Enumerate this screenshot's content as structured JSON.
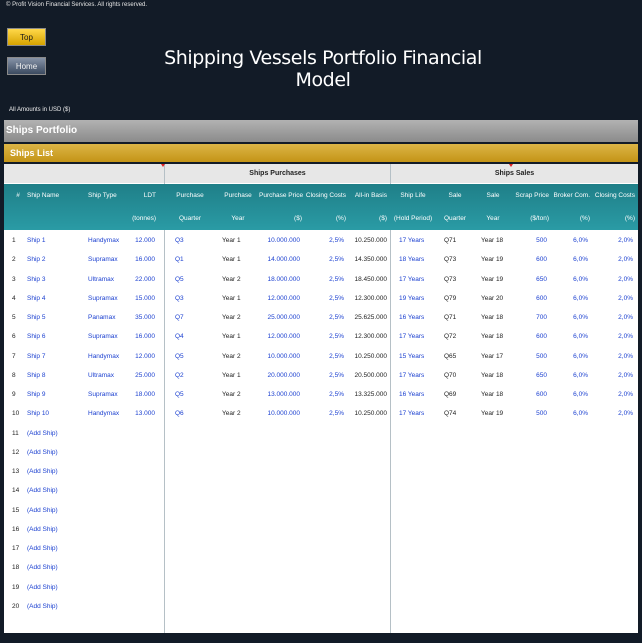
{
  "copyright": "© Profit Vision Financial Services. All rights reserved.",
  "nav": {
    "top_label": "Top",
    "home_label": "Home"
  },
  "title": "Shipping Vessels Portfolio Financial Model",
  "amounts_note": "All Amounts in  USD ($)",
  "section": "Ships Portfolio",
  "subsection": "Ships List",
  "groups": {
    "purchases": "Ships Purchases",
    "sales": "Ships Sales"
  },
  "columns": [
    {
      "key": "num",
      "h1": "#",
      "h2": ""
    },
    {
      "key": "name",
      "h1": "Ship Name",
      "h2": ""
    },
    {
      "key": "type",
      "h1": "Ship Type",
      "h2": ""
    },
    {
      "key": "ldt",
      "h1": "LDT",
      "h2": "(tonnes)"
    },
    {
      "key": "pq",
      "h1": "Purchase",
      "h2": "Quarter"
    },
    {
      "key": "py",
      "h1": "Purchase",
      "h2": "Year"
    },
    {
      "key": "pp",
      "h1": "Purchase Price",
      "h2": "($)"
    },
    {
      "key": "pc",
      "h1": "Closing Costs",
      "h2": "(%)"
    },
    {
      "key": "ab",
      "h1": "All-in Basis",
      "h2": "($)"
    },
    {
      "key": "life",
      "h1": "Ship Life",
      "h2": "(Hold Period)"
    },
    {
      "key": "sq",
      "h1": "Sale",
      "h2": "Quarter"
    },
    {
      "key": "sy",
      "h1": "Sale",
      "h2": "Year"
    },
    {
      "key": "scrap",
      "h1": "Scrap Price",
      "h2": "($/ton)"
    },
    {
      "key": "broker",
      "h1": "Broker Com.",
      "h2": "(%)"
    },
    {
      "key": "sc",
      "h1": "Closing Costs",
      "h2": "(%)"
    }
  ],
  "rows": [
    [
      "1",
      "Ship 1",
      "Handymax",
      "12.000",
      "Q3",
      "Year 1",
      "10.000.000",
      "2,5%",
      "10.250.000",
      "17 Years",
      "Q71",
      "Year 18",
      "500",
      "6,0%",
      "2,0%"
    ],
    [
      "2",
      "Ship 2",
      "Supramax",
      "16.000",
      "Q1",
      "Year 1",
      "14.000.000",
      "2,5%",
      "14.350.000",
      "18 Years",
      "Q73",
      "Year 19",
      "600",
      "6,0%",
      "2,0%"
    ],
    [
      "3",
      "Ship 3",
      "Ultramax",
      "22.000",
      "Q5",
      "Year 2",
      "18.000.000",
      "2,5%",
      "18.450.000",
      "17 Years",
      "Q73",
      "Year 19",
      "650",
      "6,0%",
      "2,0%"
    ],
    [
      "4",
      "Ship 4",
      "Supramax",
      "15.000",
      "Q3",
      "Year 1",
      "12.000.000",
      "2,5%",
      "12.300.000",
      "19 Years",
      "Q79",
      "Year 20",
      "600",
      "6,0%",
      "2,0%"
    ],
    [
      "5",
      "Ship 5",
      "Panamax",
      "35.000",
      "Q7",
      "Year 2",
      "25.000.000",
      "2,5%",
      "25.625.000",
      "16 Years",
      "Q71",
      "Year 18",
      "700",
      "6,0%",
      "2,0%"
    ],
    [
      "6",
      "Ship 6",
      "Supramax",
      "16.000",
      "Q4",
      "Year 1",
      "12.000.000",
      "2,5%",
      "12.300.000",
      "17 Years",
      "Q72",
      "Year 18",
      "600",
      "6,0%",
      "2,0%"
    ],
    [
      "7",
      "Ship 7",
      "Handymax",
      "12.000",
      "Q5",
      "Year 2",
      "10.000.000",
      "2,5%",
      "10.250.000",
      "15 Years",
      "Q65",
      "Year 17",
      "500",
      "6,0%",
      "2,0%"
    ],
    [
      "8",
      "Ship 8",
      "Ultramax",
      "25.000",
      "Q2",
      "Year 1",
      "20.000.000",
      "2,5%",
      "20.500.000",
      "17 Years",
      "Q70",
      "Year 18",
      "650",
      "6,0%",
      "2,0%"
    ],
    [
      "9",
      "Ship 9",
      "Supramax",
      "18.000",
      "Q5",
      "Year 2",
      "13.000.000",
      "2,5%",
      "13.325.000",
      "16 Years",
      "Q69",
      "Year 18",
      "600",
      "6,0%",
      "2,0%"
    ],
    [
      "10",
      "Ship 10",
      "Handymax",
      "13.000",
      "Q6",
      "Year 2",
      "10.000.000",
      "2,5%",
      "10.250.000",
      "17 Years",
      "Q74",
      "Year 19",
      "500",
      "6,0%",
      "2,0%"
    ],
    [
      "11",
      "(Add Ship)",
      "",
      "",
      "",
      "",
      "",
      "",
      "",
      "",
      "",
      "",
      "",
      "",
      ""
    ],
    [
      "12",
      "(Add Ship)",
      "",
      "",
      "",
      "",
      "",
      "",
      "",
      "",
      "",
      "",
      "",
      "",
      ""
    ],
    [
      "13",
      "(Add Ship)",
      "",
      "",
      "",
      "",
      "",
      "",
      "",
      "",
      "",
      "",
      "",
      "",
      ""
    ],
    [
      "14",
      "(Add Ship)",
      "",
      "",
      "",
      "",
      "",
      "",
      "",
      "",
      "",
      "",
      "",
      "",
      ""
    ],
    [
      "15",
      "(Add Ship)",
      "",
      "",
      "",
      "",
      "",
      "",
      "",
      "",
      "",
      "",
      "",
      "",
      ""
    ],
    [
      "16",
      "(Add Ship)",
      "",
      "",
      "",
      "",
      "",
      "",
      "",
      "",
      "",
      "",
      "",
      "",
      ""
    ],
    [
      "17",
      "(Add Ship)",
      "",
      "",
      "",
      "",
      "",
      "",
      "",
      "",
      "",
      "",
      "",
      "",
      ""
    ],
    [
      "18",
      "(Add Ship)",
      "",
      "",
      "",
      "",
      "",
      "",
      "",
      "",
      "",
      "",
      "",
      "",
      ""
    ],
    [
      "19",
      "(Add Ship)",
      "",
      "",
      "",
      "",
      "",
      "",
      "",
      "",
      "",
      "",
      "",
      "",
      ""
    ],
    [
      "20",
      "(Add Ship)",
      "",
      "",
      "",
      "",
      "",
      "",
      "",
      "",
      "",
      "",
      "",
      "",
      ""
    ]
  ]
}
